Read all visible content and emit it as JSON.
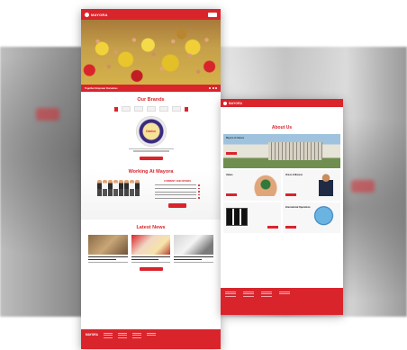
{
  "colors": {
    "brand_red": "#d9242c"
  },
  "main_page": {
    "logo": "MAYORA",
    "nav_links": [
      "",
      "",
      "",
      "",
      ""
    ],
    "hero_caption": "Together Empower Ourselves",
    "brands_title": "Our Brands",
    "brands_subtitle": "",
    "tin_label": "Danisa",
    "working_title": "Working At Mayora",
    "careers_title": "CURRENT JOB OFFERS",
    "news_title": "Latest News"
  },
  "about_page": {
    "logo": "MAYORA",
    "title": "About Us",
    "hero_label": "Mayora At Glance",
    "cells": [
      "Values",
      "Vision & Mission",
      "",
      "International Operations"
    ]
  }
}
